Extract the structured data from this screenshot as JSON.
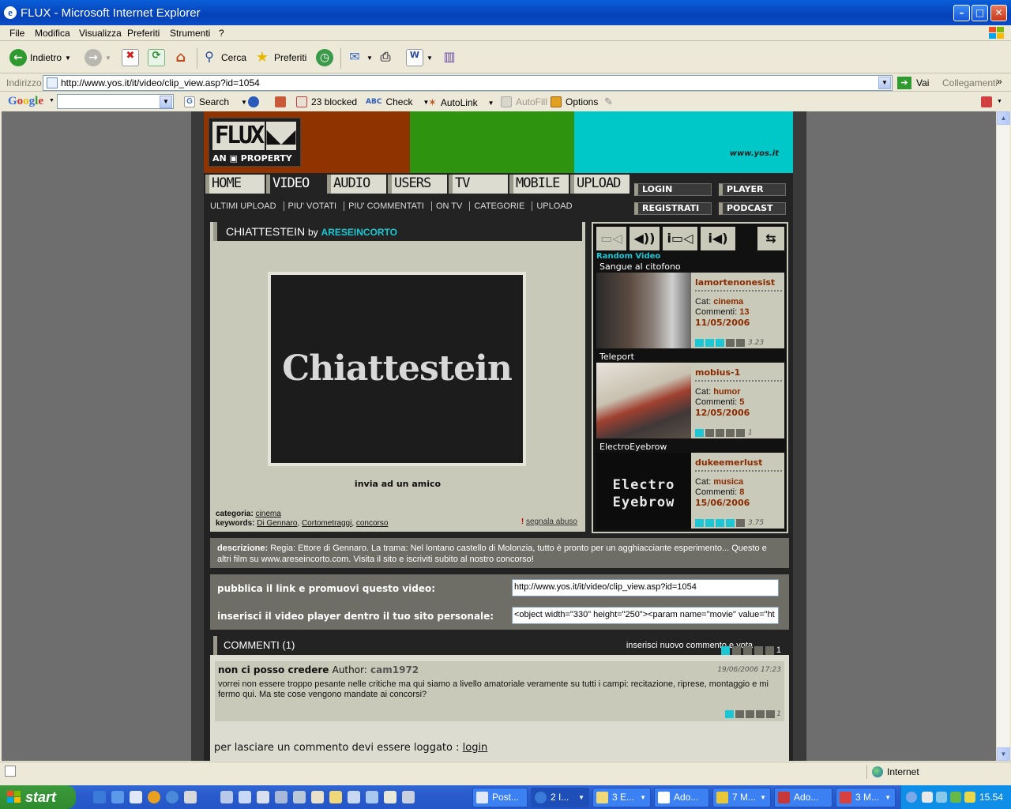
{
  "window": {
    "title": "FLUX - Microsoft Internet Explorer",
    "minimize": "–",
    "maximize": "□",
    "close": "✕"
  },
  "menu": [
    "File",
    "Modifica",
    "Visualizza",
    "Preferiti",
    "Strumenti",
    "?"
  ],
  "toolbar": {
    "back": "Indietro",
    "search": "Cerca",
    "favorites": "Preferiti"
  },
  "address": {
    "label": "Indirizzo",
    "url": "http://www.yos.it/it/video/clip_view.asp?id=1054",
    "go": "Vai",
    "links": "Collegamenti"
  },
  "googlebar": {
    "logo": "Google",
    "search": "Search",
    "blocked": "23 blocked",
    "check": "Check",
    "autolink": "AutoLink",
    "autofill": "AutoFill",
    "options": "Options"
  },
  "site": {
    "logo_text": "FLUX",
    "logo_sub": "AN ▣ PROPERTY",
    "url": "www.yos.it",
    "nav": [
      "HOME",
      "VIDEO",
      "AUDIO",
      "USERS",
      "TV",
      "MOBILE",
      "UPLOAD"
    ],
    "subnav": [
      "ULTIMI UPLOAD",
      "PIU' VOTATI",
      "PIU' COMMENTATI",
      "ON TV",
      "CATEGORIE",
      "UPLOAD"
    ],
    "side_buttons": {
      "login": "LOGIN",
      "player": "PLAYER",
      "register": "REGISTRATI",
      "podcast": "PODCAST"
    }
  },
  "video": {
    "title": "CHIATTESTEIN",
    "by": "by",
    "author": "ARESEINCORTO",
    "poster_text": "Chiattestein",
    "send_friend": "invia ad un amico",
    "category_label": "categoria:",
    "category": "cinema",
    "keywords_label": "keywords:",
    "keywords": [
      "Di Gennaro",
      "Cortometraggi",
      "concorso"
    ],
    "report": "segnala abuso"
  },
  "random": {
    "label": "Random Video",
    "items": [
      {
        "title": "Sangue al citofono",
        "user": "lamortenonesist",
        "cat_label": "Cat:",
        "cat": "cinema",
        "comments_label": "Commenti:",
        "comments": "13",
        "date": "11/05/2006",
        "rating": 3.23,
        "rating_label": "3.23"
      },
      {
        "title": "Teleport",
        "user": "mobius-1",
        "cat_label": "Cat:",
        "cat": "humor",
        "comments_label": "Commenti:",
        "comments": "5",
        "date": "12/05/2006",
        "rating": 1,
        "rating_label": "1"
      },
      {
        "title": "ElectroEyebrow",
        "user": "dukeemerlust",
        "cat_label": "Cat:",
        "cat": "musica",
        "comments_label": "Commenti:",
        "comments": "8",
        "date": "15/06/2006",
        "rating": 3.75,
        "rating_label": "3.75",
        "thumb_text": "Electro Eyebrow"
      }
    ]
  },
  "description": {
    "label": "descrizione:",
    "text": "Regia: Ettore di Gennaro. La trama: Nel lontano castello di Molonzia, tutto è pronto per un agghiacciante esperimento... Questo e altri film su www.areseincorto.com. Visita il sito e iscriviti subito al nostro concorso!"
  },
  "share": {
    "link_label": "pubblica il link e promuovi questo video:",
    "link_value": "http://www.yos.it/it/video/clip_view.asp?id=1054",
    "embed_label": "inserisci il video player dentro il tuo sito personale:",
    "embed_value": "<object width=\"330\" height=\"250\"><param name=\"movie\" value=\"ht"
  },
  "comments": {
    "header": "COMMENTI",
    "count": "(1)",
    "add": "inserisci nuovo commento e vota",
    "vote_value": 1,
    "vote_label": "1",
    "items": [
      {
        "title": "non ci posso credere",
        "author_label": "Author:",
        "author": "cam1972",
        "date": "19/06/2006 17:23",
        "text": "vorrei non essere troppo pesante nelle critiche ma qui siamo a livello amatoriale veramente su tutti i campi: recitazione, riprese, montaggio e mi fermo qui. Ma ste cose vengono mandate ai concorsi?",
        "rating": 1,
        "rating_label": "1"
      }
    ],
    "login_note": "per lasciare un commento devi essere loggato :",
    "login_link": "login"
  },
  "status": {
    "zone": "Internet"
  },
  "taskbar": {
    "start": "start",
    "tasks": [
      "Post...",
      "2 I...",
      "3 E...",
      "Ado...",
      "7 M...",
      "Ado...",
      "3 M..."
    ],
    "clock": "15.54"
  }
}
